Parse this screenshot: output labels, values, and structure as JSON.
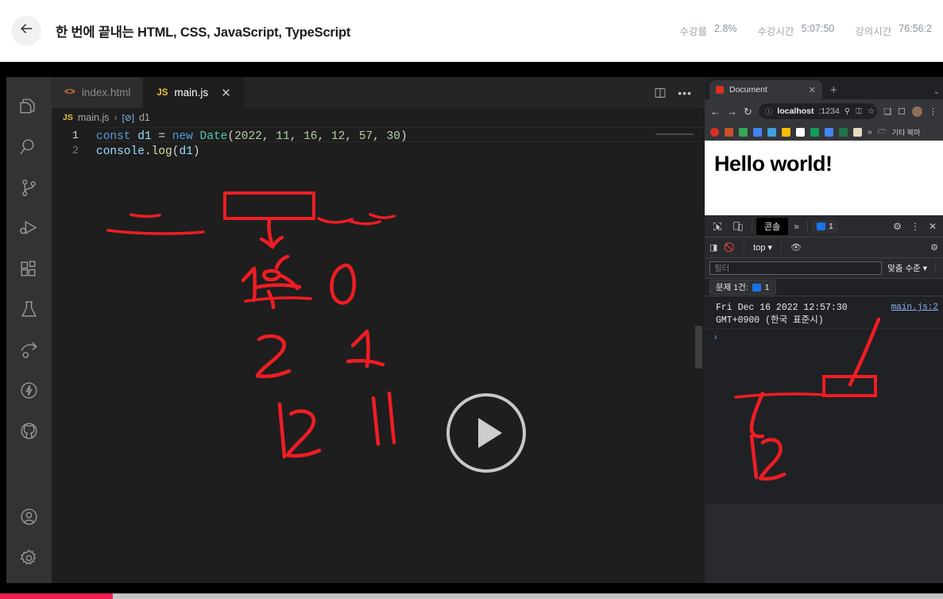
{
  "header": {
    "back_icon": "arrow-left-icon",
    "title": "한 번에 끝내는 HTML, CSS, JavaScript, TypeScript",
    "stats": [
      {
        "label": "수강률",
        "value": "2.8%"
      },
      {
        "label": "수강시간",
        "value": "5:07:50"
      },
      {
        "label": "강의시간",
        "value": "76:56:2"
      }
    ]
  },
  "vscode": {
    "activity_bar": [
      {
        "name": "explorer-icon",
        "label": "Explorer"
      },
      {
        "name": "search-icon",
        "label": "Search"
      },
      {
        "name": "source-control-icon",
        "label": "Source Control"
      },
      {
        "name": "run-and-debug-icon",
        "label": "Run and Debug"
      },
      {
        "name": "extensions-icon",
        "label": "Extensions"
      },
      {
        "name": "testing-icon",
        "label": "Testing"
      },
      {
        "name": "live-share-icon",
        "label": "Live Share"
      },
      {
        "name": "thunder-client-icon",
        "label": "Thunder Client"
      },
      {
        "name": "github-icon",
        "label": "GitHub"
      }
    ],
    "activity_bar_bottom": [
      {
        "name": "account-icon",
        "label": "Accounts"
      },
      {
        "name": "settings-gear-icon",
        "label": "Manage"
      }
    ],
    "tabs": [
      {
        "label": "index.html",
        "icon": "html-file-icon",
        "icon_text": "<>",
        "active": false
      },
      {
        "label": "main.js",
        "icon": "js-file-icon",
        "icon_text": "JS",
        "active": true,
        "close": "✕"
      }
    ],
    "tab_actions": [
      {
        "name": "split-editor-icon"
      },
      {
        "name": "more-actions-icon",
        "label": "•••"
      }
    ],
    "breadcrumb": {
      "file_icon_text": "JS",
      "file": "main.js",
      "separator": "›",
      "symbol_icon": "[⊘]",
      "symbol": "d1"
    },
    "code": {
      "lines": [
        {
          "number": "1",
          "tokens": [
            {
              "t": "const",
              "c": "kw"
            },
            {
              "t": " ",
              "c": "op"
            },
            {
              "t": "d1",
              "c": "vr"
            },
            {
              "t": " = ",
              "c": "op"
            },
            {
              "t": "new",
              "c": "kw"
            },
            {
              "t": " ",
              "c": "op"
            },
            {
              "t": "Date",
              "c": "cls"
            },
            {
              "t": "(",
              "c": "punc"
            },
            {
              "t": "2022",
              "c": "num"
            },
            {
              "t": ", ",
              "c": "punc"
            },
            {
              "t": "11",
              "c": "num"
            },
            {
              "t": ", ",
              "c": "punc"
            },
            {
              "t": "16",
              "c": "num"
            },
            {
              "t": ", ",
              "c": "punc"
            },
            {
              "t": "12",
              "c": "num"
            },
            {
              "t": ", ",
              "c": "punc"
            },
            {
              "t": "57",
              "c": "num"
            },
            {
              "t": ", ",
              "c": "punc"
            },
            {
              "t": "30",
              "c": "num"
            },
            {
              "t": ")",
              "c": "punc"
            }
          ]
        },
        {
          "number": "2",
          "tokens": [
            {
              "t": "console",
              "c": "obj"
            },
            {
              "t": ".",
              "c": "punc"
            },
            {
              "t": "log",
              "c": "prop"
            },
            {
              "t": "(",
              "c": "punc"
            },
            {
              "t": "d1",
              "c": "vr"
            },
            {
              "t": ")",
              "c": "punc"
            }
          ]
        }
      ]
    }
  },
  "browser": {
    "tab": {
      "title": "Document",
      "close": "✕"
    },
    "new_tab": "+",
    "window_menu": "⌄",
    "nav": {
      "back": "←",
      "forward": "→",
      "reload": "↻"
    },
    "omnibox": {
      "info_icon": "ⓘ",
      "host": "localhost",
      "port": ":1234",
      "zoom_icon": "search-icon",
      "share_icon": "share-icon",
      "star_icon": "☆"
    },
    "toolbar_icons": [
      "extensions-puzzle-icon",
      "sidepanel-icon",
      "profile-avatar-icon",
      "chrome-menu-icon"
    ],
    "bookmarks": {
      "items": [
        "#d93025",
        "#c8522a",
        "#34a853",
        "#4285f4",
        "#3ca0e0",
        "#fbbc04",
        "#ffffff",
        "#0f9d58",
        "#4285f4",
        "#217346",
        "#e8eaed"
      ],
      "overflow": "»",
      "folder_icon": "folder-icon",
      "folder_label": "기타 북마"
    },
    "page": {
      "heading": "Hello world!"
    }
  },
  "devtools": {
    "toolbar": {
      "inspect_icon": "inspect-element-icon",
      "device_icon": "device-toolbar-icon",
      "active_tab": "콘솔",
      "more_tabs": "»",
      "issues_count": "1",
      "settings_icon": "settings-gear-icon",
      "kebab_icon": "more-options-icon",
      "close_icon": "close-icon"
    },
    "subbar": {
      "sidebar_icon": "console-sidebar-icon",
      "clear_icon": "clear-console-icon",
      "context": "top",
      "context_caret": "▾",
      "eye_icon": "live-expression-icon",
      "settings_icon": "settings-gear-icon"
    },
    "filterbar": {
      "filter_placeholder": "필터",
      "filter_value": "",
      "level": "맞춤 수준",
      "level_caret": "▾"
    },
    "issue_bar": {
      "text": "문제 1건:",
      "count": "1"
    },
    "console": {
      "entries": [
        {
          "message": "Fri Dec 16 2022 12:57:30",
          "message_line2": "GMT+0900 (한국 표준시)",
          "source": "main.js:2"
        }
      ],
      "prompt_caret": "›"
    }
  },
  "player": {
    "play_icon": "play-button-icon",
    "progress_percent": 12
  },
  "annotations": {
    "editor_ink": [
      {
        "name": "ink-month-label-1",
        "text": "1월"
      },
      {
        "name": "ink-month-index-0",
        "text": "0"
      },
      {
        "name": "ink-month-label-2",
        "text": "2"
      },
      {
        "name": "ink-month-index-1",
        "text": "1"
      },
      {
        "name": "ink-month-label-12",
        "text": "12"
      },
      {
        "name": "ink-month-index-11",
        "text": "11"
      }
    ],
    "console_ink": [
      {
        "name": "ink-console-12",
        "text": "12"
      }
    ]
  },
  "colors": {
    "accent_red": "#ee1d24",
    "progress_pink": "#f0204f",
    "vscode_bg": "#1e1e1e",
    "devtools_bg": "#202124"
  }
}
